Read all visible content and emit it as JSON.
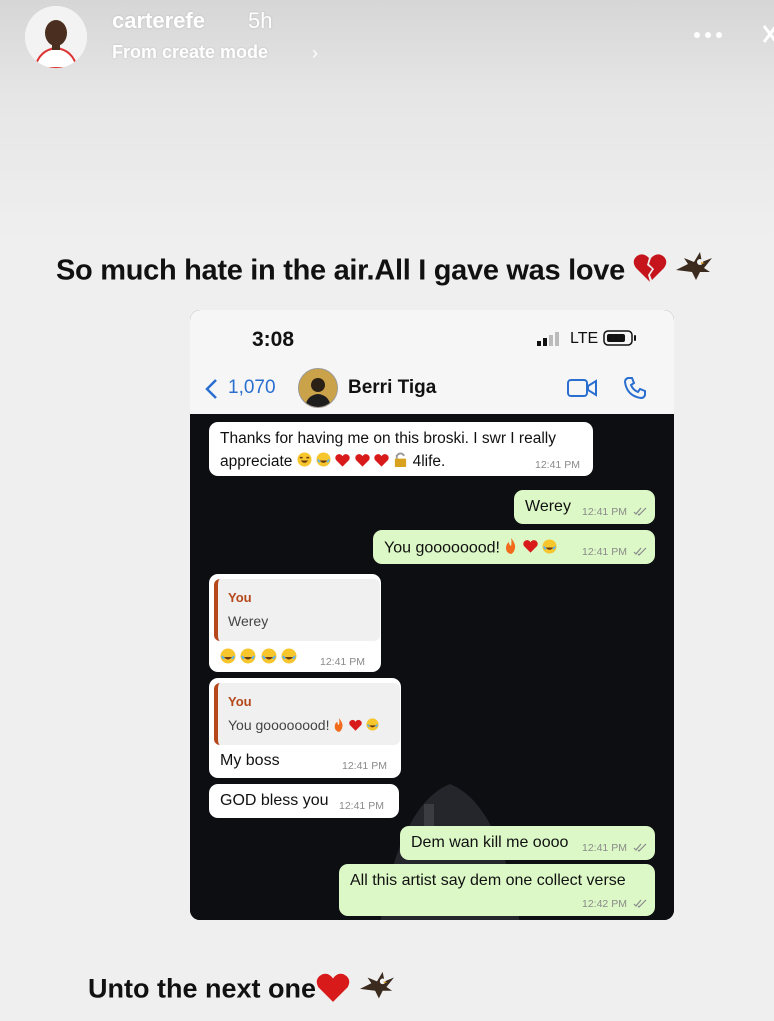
{
  "story": {
    "username": "carterefe",
    "time": "5h",
    "subtitle": "From create mode",
    "caption_top": "So much hate in the air.All I gave was love",
    "caption_bottom": "Unto the next one"
  },
  "phone": {
    "clock": "3:08",
    "network": "LTE",
    "back_count": "1,070",
    "contact_name": "Berri Tiga"
  },
  "messages": {
    "m1_line1": "Thanks for having me on this broski.  I swr I really",
    "m1_line2_prefix": "appreciate",
    "m1_line2_suffix": "4life.",
    "m1_time": "12:41 PM",
    "m2_text": "Werey",
    "m2_time": "12:41 PM",
    "m3_text": "You goooooood!",
    "m3_time": "12:41 PM",
    "m4_quote_name": "You",
    "m4_quote_text": "Werey",
    "m4_time": "12:41 PM",
    "m5_quote_name": "You",
    "m5_quote_text": "You goooooood!",
    "m5_text": "My boss",
    "m5_time": "12:41 PM",
    "m6_text": "GOD bless you",
    "m6_time": "12:41 PM",
    "m7_text": "Dem wan kill me oooo",
    "m7_time": "12:41 PM",
    "m8_text": "All this artist say dem one collect verse",
    "m8_time": "12:42 PM"
  },
  "icons": {
    "broken_heart": "broken-heart-icon",
    "heart": "heart-icon",
    "eagle": "eagle-icon",
    "laugh": "tears-of-joy-icon",
    "fire": "fire-icon",
    "lock": "lock-icon"
  },
  "colors": {
    "ios_blue": "#2a6fd0",
    "bubble_out": "#dcf8c6",
    "bubble_in": "#ffffff",
    "chat_bg": "#0d0e11",
    "quote_accent": "#b5471b"
  }
}
